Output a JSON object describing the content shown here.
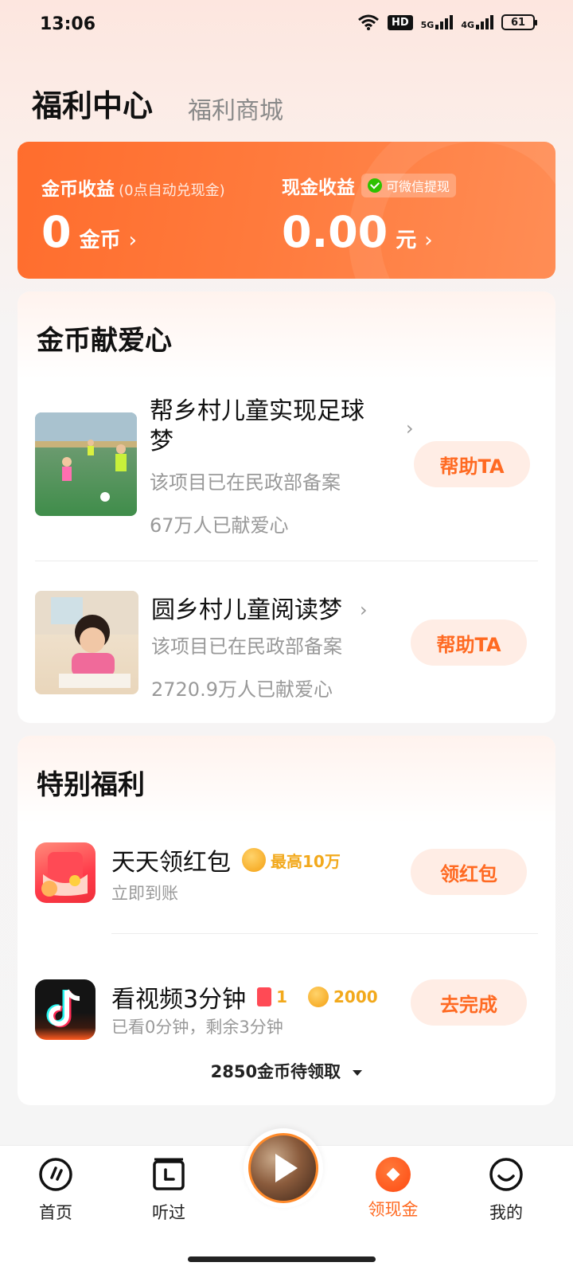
{
  "status": {
    "time": "13:06",
    "hd": "HD",
    "net1": "5G",
    "net2": "4G",
    "battery": "61"
  },
  "tabs": {
    "active": "福利中心",
    "inactive": "福利商城"
  },
  "earnings": {
    "coin_label": "金币收益",
    "coin_note": "(0点自动兑现金)",
    "coin_value": "0",
    "coin_unit": "金币",
    "cash_label": "现金收益",
    "cash_badge": "可微信提现",
    "cash_value": "0.00",
    "cash_unit": "元",
    "chevron": "›"
  },
  "charity": {
    "title": "金币献爱心",
    "items": [
      {
        "title_line1": "帮乡村儿童实现足球",
        "title_line2": "梦",
        "sub": "该项目已在民政部备案",
        "count": "67万人已献爱心",
        "button": "帮助TA"
      },
      {
        "title_line1": "圆乡村儿童阅读梦",
        "sub": "该项目已在民政部备案",
        "count": "2720.9万人已献爱心",
        "button": "帮助TA"
      }
    ]
  },
  "special": {
    "title": "特别福利",
    "items": [
      {
        "title": "天天领红包",
        "reward": "最高10万",
        "sub": "立即到账",
        "button": "领红包"
      },
      {
        "title": "看视频3分钟",
        "reward_count": "1",
        "reward_coins": "2000",
        "sub": "已看0分钟，剩余3分钟",
        "button": "去完成"
      }
    ],
    "pending": "2850金币待领取"
  },
  "nav": {
    "home": "首页",
    "history": "听过",
    "cash": "领现金",
    "mine": "我的"
  },
  "colors": {
    "accent": "#ff6a22",
    "card_orange": "#ff7a3c",
    "button_bg": "#ffede5"
  }
}
